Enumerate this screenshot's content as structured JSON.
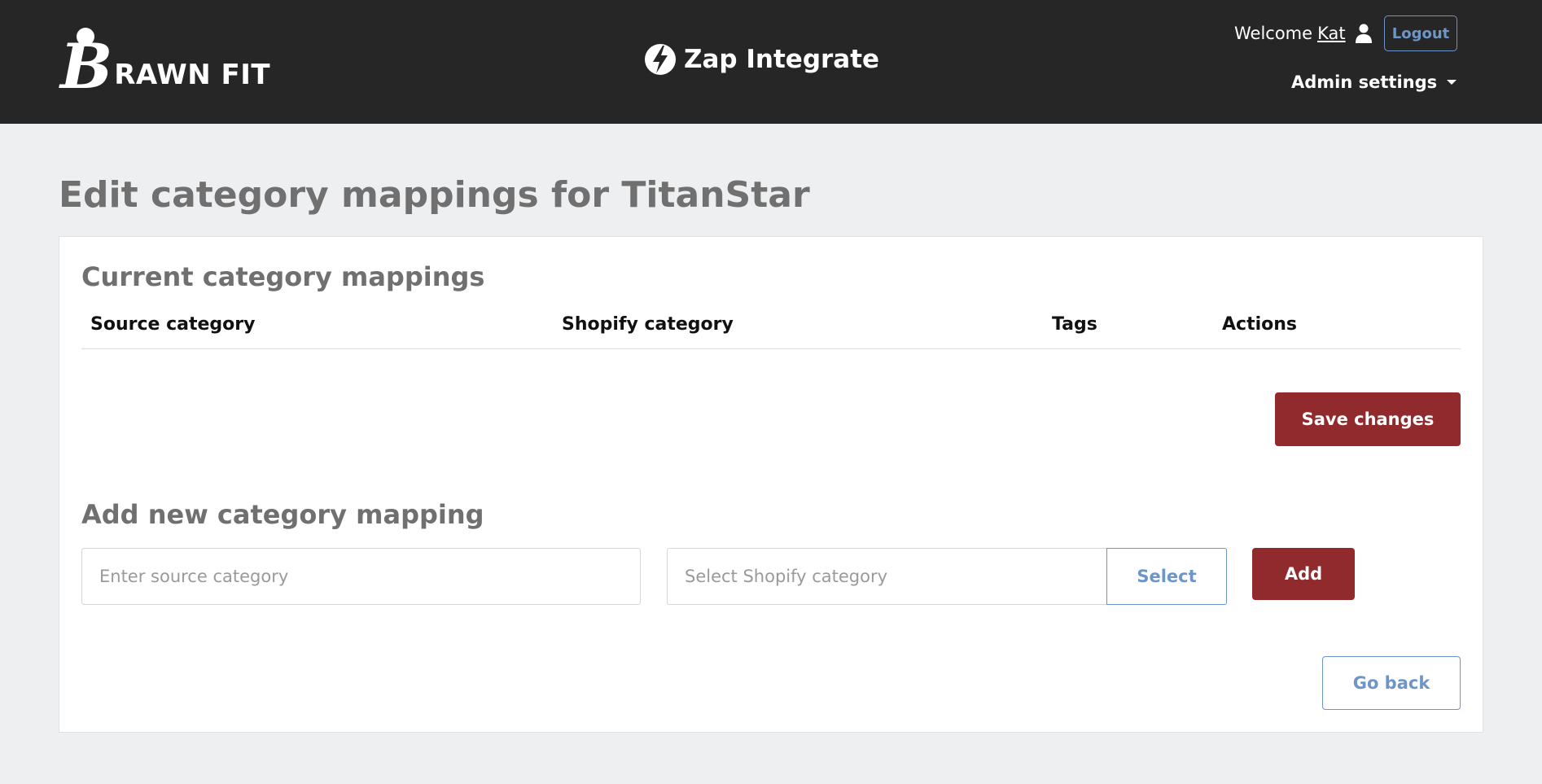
{
  "header": {
    "brand_letter": "B",
    "brand_text": "RAWN FIT",
    "app_title": "Zap Integrate",
    "welcome_label": "Welcome",
    "username": "Kat",
    "logout_label": "Logout",
    "admin_settings_label": "Admin settings"
  },
  "page": {
    "title": "Edit category mappings for TitanStar"
  },
  "current_mappings": {
    "title": "Current category mappings",
    "columns": [
      "Source category",
      "Shopify category",
      "Tags",
      "Actions"
    ],
    "rows": [],
    "save_label": "Save changes"
  },
  "add_mapping": {
    "title": "Add new category mapping",
    "source_placeholder": "Enter source category",
    "shopify_placeholder": "Select Shopify category",
    "select_label": "Select",
    "add_label": "Add"
  },
  "footer": {
    "go_back_label": "Go back"
  },
  "colors": {
    "header_bg": "#262626",
    "primary": "#912a2c",
    "accent_blue": "#6e95c8",
    "title_gray": "#707070",
    "page_bg": "#eeeff1"
  },
  "icons": [
    "brawn-fit-logo",
    "lightning-bolt-icon",
    "user-icon",
    "caret-down-icon"
  ]
}
